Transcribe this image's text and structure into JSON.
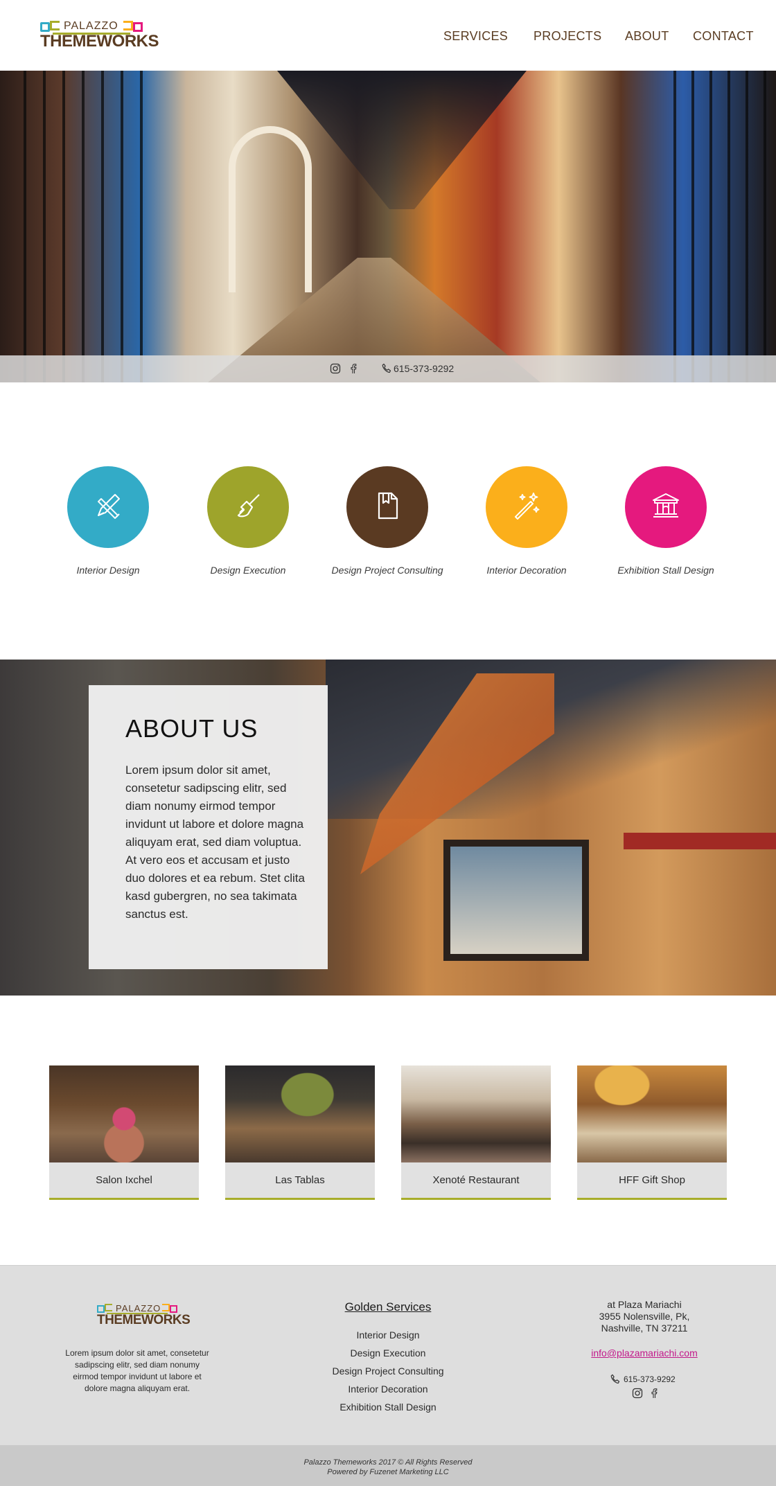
{
  "brand": {
    "top": "PALAZZO",
    "main": "THEMEWORKS",
    "colors": {
      "brown": "#5a3c22",
      "olive": "#a7ad2b",
      "teal": "#33abc7",
      "pink": "#e5197e",
      "orange": "#fbaf1b"
    }
  },
  "nav": {
    "services": "SERVICES",
    "projects": "PROJECTS",
    "about": "ABOUT",
    "contact": "CONTACT"
  },
  "hero": {
    "phone": "615-373-9292",
    "icons": [
      "instagram-icon",
      "facebook-icon",
      "phone-icon"
    ]
  },
  "services": [
    {
      "label": "Interior Design",
      "color": "#33abc7",
      "icon": "pencil-brush-icon"
    },
    {
      "label": "Design Execution",
      "color": "#9ea42b",
      "icon": "paint-brush-icon"
    },
    {
      "label": "Design Project Consulting",
      "color": "#5a3a22",
      "icon": "document-bookmark-icon"
    },
    {
      "label": "Interior Decoration",
      "color": "#fbaf1b",
      "icon": "magic-wand-icon"
    },
    {
      "label": "Exhibition Stall Design",
      "color": "#e5197e",
      "icon": "museum-icon"
    }
  ],
  "about": {
    "title": "ABOUT US",
    "text": "Lorem ipsum dolor sit amet, consetetur sadipscing elitr, sed diam nonumy eirmod tempor invidunt ut labore et dolore magna aliquyam erat, sed diam voluptua. At vero eos et accusam et justo duo dolores et ea rebum. Stet clita kasd gubergren, no sea takimata sanctus est."
  },
  "projects": [
    {
      "name": "Salon Ixchel"
    },
    {
      "name": "Las Tablas"
    },
    {
      "name": "Xenoté Restaurant"
    },
    {
      "name": "HFF Gift Shop"
    }
  ],
  "footer": {
    "about": "Lorem ipsum dolor sit amet, consetetur sadipscing elitr, sed diam nonumy eirmod tempor invidunt ut labore et dolore magna aliquyam erat.",
    "services_title": "Golden Services",
    "services": [
      "Interior Design",
      "Design Execution",
      "Design Project Consulting",
      "Interior Decoration",
      "Exhibition Stall Design"
    ],
    "address": [
      "at Plaza Mariachi",
      "3955 Nolensville, Pk,",
      "Nashville, TN 37211"
    ],
    "email": "info@plazamariachi.com",
    "phone": "615-373-9292"
  },
  "copyright": {
    "line1": "Palazzo Themeworks 2017 © All Rights Reserved",
    "line2": "Powered by Fuzenet Marketing LLC"
  }
}
